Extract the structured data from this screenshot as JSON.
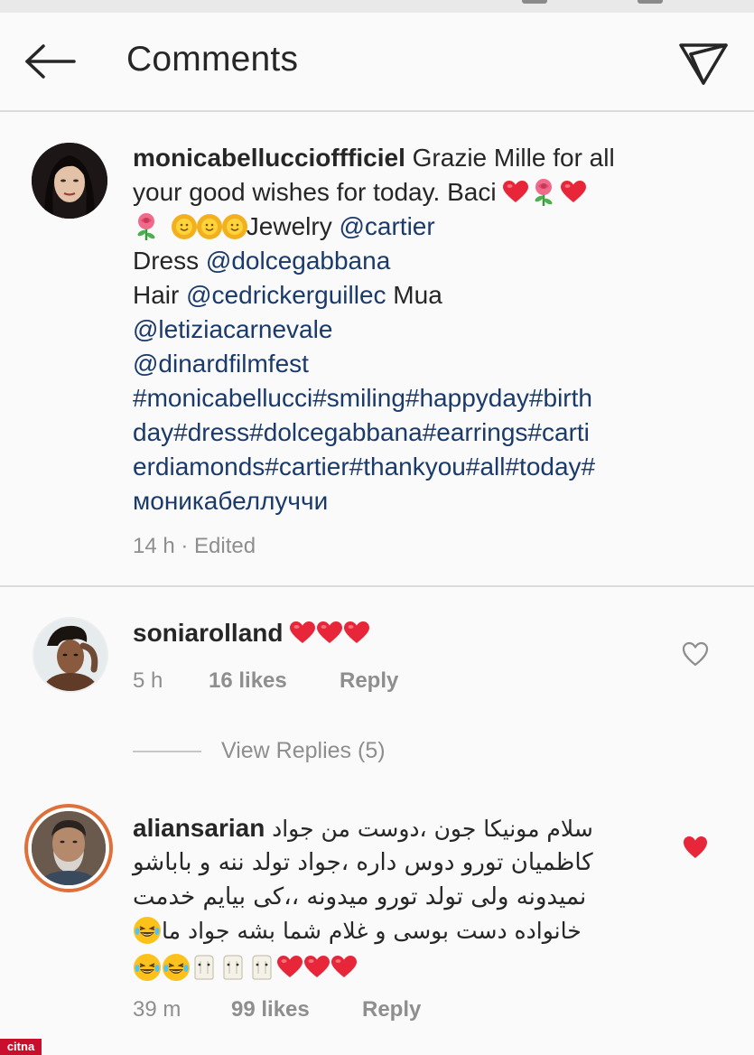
{
  "header": {
    "title": "Comments",
    "back_icon": "arrow-left-icon",
    "share_icon": "direct-send-icon"
  },
  "caption": {
    "username": "monicabelluccioffficiel",
    "text_1": "Grazie Mille for all",
    "text_2": "your good wishes for today. Baci",
    "text_3": "Jewelry",
    "mention_cartier": "@cartier",
    "dress_label": "Dress",
    "mention_dolce": "@dolcegabbana",
    "hair_label": "Hair",
    "mention_cedric": "@cedrickerguillec",
    "mua_label": "Mua",
    "mention_letizia": "@letiziacarnevale",
    "mention_dinard": "@dinardfilmfest",
    "hashtags_1": "#monicabellucci#smiling#happyday#birth",
    "hashtags_2": "day#dress#dolcegabbana#earrings#carti",
    "hashtags_3": "erdiamonds#cartier#thankyou#all#today#",
    "hashtags_4": "моникабеллуччи",
    "time": "14 h · Edited"
  },
  "comments": [
    {
      "username": "soniarolland",
      "time": "5 h",
      "likes": "16 likes",
      "reply": "Reply",
      "view_replies": "View Replies (5)",
      "liked": false
    },
    {
      "username": "aliansarian",
      "line_1": "سلام مونیکا جون ،دوست من جواد",
      "line_2": "کاظمیان تورو دوس داره ،جواد تولد ننه و باباشو",
      "line_3": "نمیدونه ولی تولد تورو میدونه ،،کی بیایم خدمت",
      "line_4": "خانواده دست بوسی و غلام شما بشه جواد ما",
      "time": "39 m",
      "likes": "99 likes",
      "reply": "Reply",
      "liked": true
    }
  ],
  "watermark": "citna",
  "colors": {
    "heart_red": "#e8263a",
    "link_blue": "#1a3a6b",
    "meta_gray": "#8e8e8e"
  }
}
